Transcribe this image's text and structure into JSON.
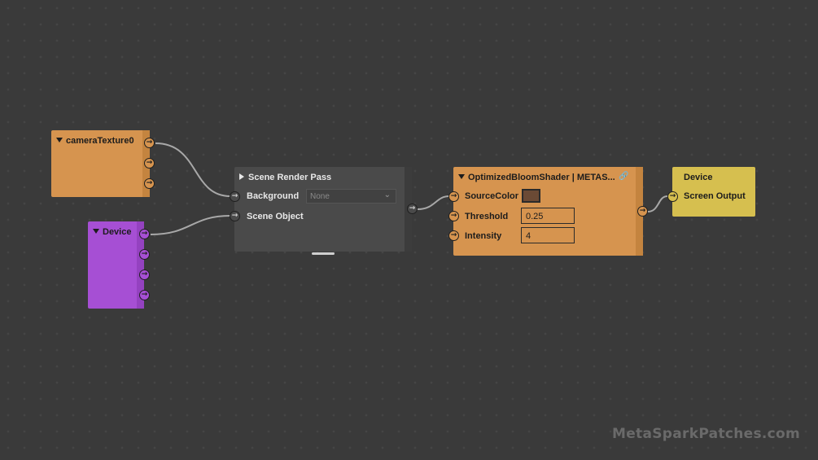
{
  "colors": {
    "canvas": "#2b2b2b",
    "orange_node": "#d6944f",
    "purple_node": "#a64fd4",
    "gray_node": "#4a4a4a",
    "yellow_node": "#d6bf4f",
    "wire": "#a8a8a8",
    "source_color_swatch": "#6b4a35"
  },
  "nodes": {
    "camera_texture": {
      "title": "cameraTexture0",
      "outputs": 3
    },
    "device_left": {
      "title": "Device",
      "outputs": 4
    },
    "scene_render_pass": {
      "title": "Scene Render Pass",
      "inputs": [
        {
          "label": "Background",
          "value": "None",
          "placeholder": "None"
        },
        {
          "label": "Scene Object"
        }
      ]
    },
    "bloom_shader": {
      "title": "OptimizedBloomShader | METAS...",
      "inputs": [
        {
          "label": "SourceColor"
        },
        {
          "label": "Threshold",
          "value": "0.25"
        },
        {
          "label": "Intensity",
          "value": "4"
        }
      ]
    },
    "device_output": {
      "title": "Device",
      "inputs": [
        {
          "label": "Screen Output"
        }
      ]
    }
  },
  "icons": {
    "port_arrow": "→",
    "collapse": "triangle-down-icon",
    "expand": "triangle-right-icon",
    "dropdown": "chevron-down-icon",
    "link": "link-icon"
  },
  "watermark": "MetaSparkPatches.com"
}
